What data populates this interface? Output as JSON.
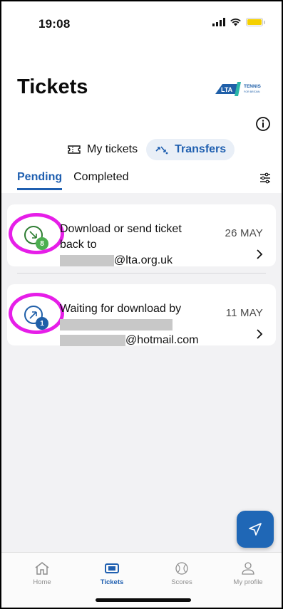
{
  "status_bar": {
    "time": "19:08"
  },
  "header": {
    "title": "Tickets",
    "logo_text": "LTA",
    "logo_sub": "TENNIS",
    "logo_sub2": "FOR BRITAIN"
  },
  "segmented": {
    "items": [
      {
        "label": "My tickets",
        "icon": "ticket-icon",
        "active": false
      },
      {
        "label": "Transfers",
        "icon": "transfer-icon",
        "active": true
      }
    ]
  },
  "subtabs": {
    "items": [
      {
        "label": "Pending",
        "active": true
      },
      {
        "label": "Completed",
        "active": false
      }
    ]
  },
  "transfers": [
    {
      "line1": "Download or send ticket",
      "line2": "back to",
      "email_suffix": "@lta.org.uk",
      "date": "26 MAY",
      "badge": "8",
      "badge_color": "#4caf50",
      "icon_color": "#2e7d32"
    },
    {
      "line1": "Waiting for download by",
      "email_suffix": "@hotmail.com",
      "date": "11 MAY",
      "badge": "1",
      "badge_color": "#1f5fa8",
      "icon_color": "#1f5fa8"
    }
  ],
  "tabbar": {
    "items": [
      {
        "label": "Home",
        "icon": "home-icon",
        "active": false
      },
      {
        "label": "Tickets",
        "icon": "ticket-icon",
        "active": true
      },
      {
        "label": "Scores",
        "icon": "tennis-ball-icon",
        "active": false
      },
      {
        "label": "My profile",
        "icon": "profile-icon",
        "active": false
      }
    ]
  },
  "colors": {
    "accent": "#1f5fb0",
    "highlight_ring": "#e61ee8"
  }
}
